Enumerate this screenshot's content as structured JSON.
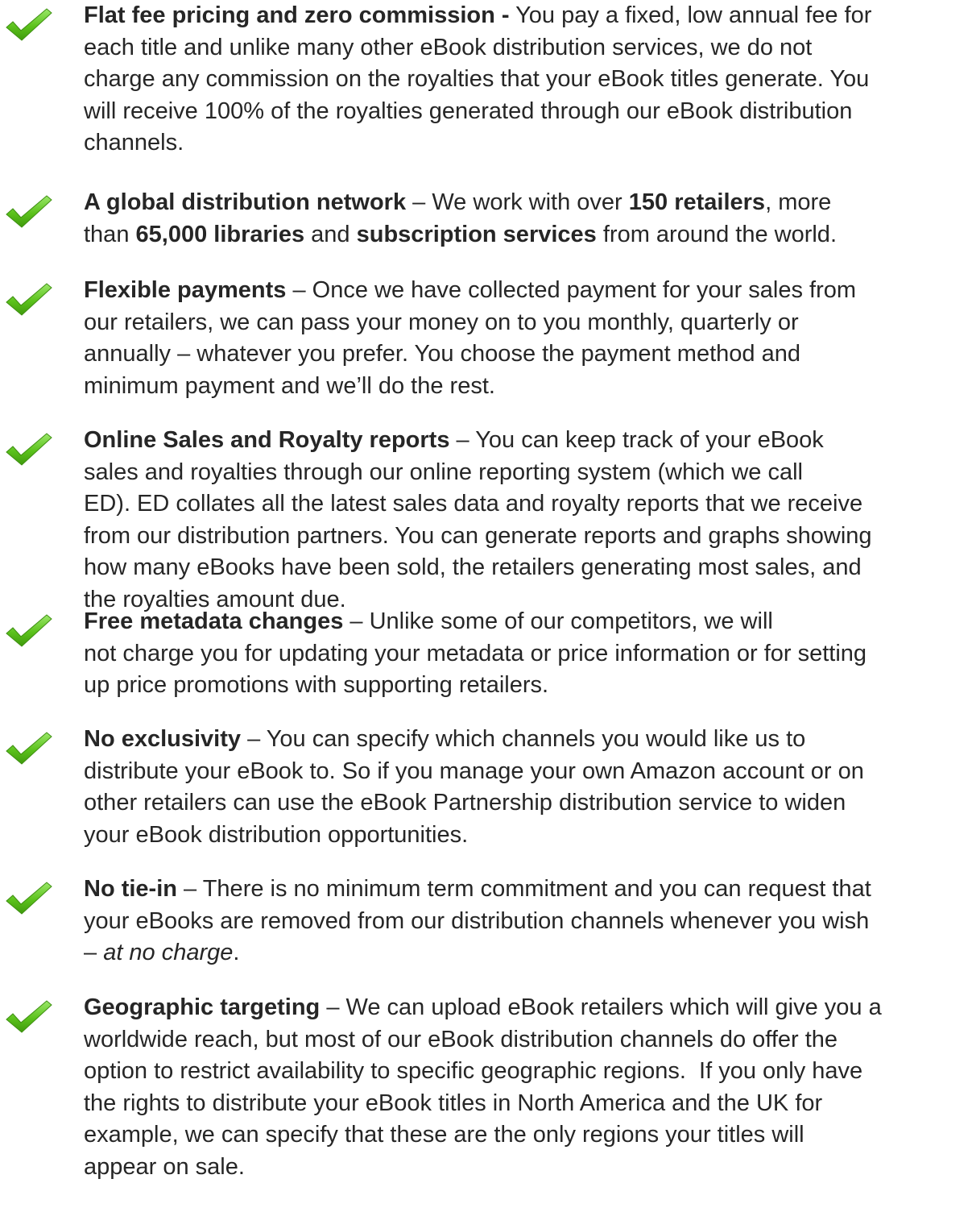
{
  "icon": "check-mark-icon",
  "check_color": "#5cc21c",
  "items": [
    {
      "title": "Flat fee pricing and zero commission -",
      "lines": [
        [
          {
            "t": "Flat fee pricing and zero commission -",
            "b": true
          },
          {
            "t": " You pay a fixed, low annual fee for"
          }
        ],
        [
          {
            "t": "each title and unlike many other eBook distribution services, we do not"
          }
        ],
        [
          {
            "t": "charge any commission on the royalties that your eBook titles generate. You"
          }
        ],
        [
          {
            "t": "will receive 100% of the royalties generated through our eBook distribution"
          }
        ],
        [
          {
            "t": "channels."
          }
        ]
      ]
    },
    {
      "title": "A global distribution network",
      "lines": [
        [
          {
            "t": "A global distribution network",
            "b": true
          },
          {
            "t": " – We work with over "
          },
          {
            "t": "150 retailers",
            "b": true
          },
          {
            "t": ", more"
          }
        ],
        [
          {
            "t": "than "
          },
          {
            "t": "65,000 libraries",
            "b": true
          },
          {
            "t": " and "
          },
          {
            "t": "subscription services",
            "b": true
          },
          {
            "t": " from around the world."
          }
        ]
      ]
    },
    {
      "title": "Flexible payments",
      "lines": [
        [
          {
            "t": "Flexible payments",
            "b": true
          },
          {
            "t": " – Once we have collected payment for your sales from"
          }
        ],
        [
          {
            "t": "our retailers, we can pass your money on to you monthly, quarterly or"
          }
        ],
        [
          {
            "t": "annually – whatever you prefer. You choose the payment method and"
          }
        ],
        [
          {
            "t": "minimum payment and we’ll do the rest."
          }
        ]
      ]
    },
    {
      "title": "Online Sales and Royalty reports",
      "lines": [
        [
          {
            "t": "Online Sales and Royalty reports",
            "b": true
          },
          {
            "t": " – You can keep track of your eBook"
          }
        ],
        [
          {
            "t": "sales and royalties through our online reporting system (which we call"
          }
        ],
        [
          {
            "t": "ED). ED collates all the latest sales data and royalty reports that we receive"
          }
        ],
        [
          {
            "t": "from our distribution partners. You can generate reports and graphs showing"
          }
        ],
        [
          {
            "t": "how many eBooks have been sold, the retailers generating most sales, and"
          }
        ],
        [
          {
            "t": "the royalties amount due."
          }
        ]
      ]
    },
    {
      "title": "Free metadata changes",
      "lines": [
        [
          {
            "t": "Free metadata changes",
            "b": true
          },
          {
            "t": " – Unlike some of our competitors, we will"
          }
        ],
        [
          {
            "t": "not charge you for updating your metadata or price information or for setting"
          }
        ],
        [
          {
            "t": "up price promotions with supporting retailers."
          }
        ]
      ]
    },
    {
      "title": "No exclusivity",
      "lines": [
        [
          {
            "t": "No exclusivity",
            "b": true
          },
          {
            "t": " – You can specify which channels you would like us to"
          }
        ],
        [
          {
            "t": "distribute your eBook to. So if you manage your own Amazon account or on"
          }
        ],
        [
          {
            "t": "other retailers can use the eBook Partnership distribution service to widen"
          }
        ],
        [
          {
            "t": "your eBook distribution opportunities."
          }
        ]
      ]
    },
    {
      "title": "No tie-in",
      "lines": [
        [
          {
            "t": "No tie-in",
            "b": true
          },
          {
            "t": " – There is no minimum term commitment and you can request that"
          }
        ],
        [
          {
            "t": "your eBooks are removed from our distribution channels whenever you wish"
          }
        ],
        [
          {
            "t": "– "
          },
          {
            "t": "at no charge",
            "i": true
          },
          {
            "t": "."
          }
        ]
      ]
    },
    {
      "title": "Geographic targeting",
      "lines": [
        [
          {
            "t": "Geographic targeting",
            "b": true
          },
          {
            "t": " – We can upload eBook retailers which will give you a"
          }
        ],
        [
          {
            "t": "worldwide reach, but most of our eBook distribution channels do offer the"
          }
        ],
        [
          {
            "t": "option to restrict availability to specific geographic regions.  If you only have"
          }
        ],
        [
          {
            "t": "the rights to distribute your eBook titles in North America and the UK for"
          }
        ],
        [
          {
            "t": "example, we can specify that these are the only regions your titles will"
          }
        ],
        [
          {
            "t": "appear on sale."
          }
        ]
      ]
    }
  ]
}
